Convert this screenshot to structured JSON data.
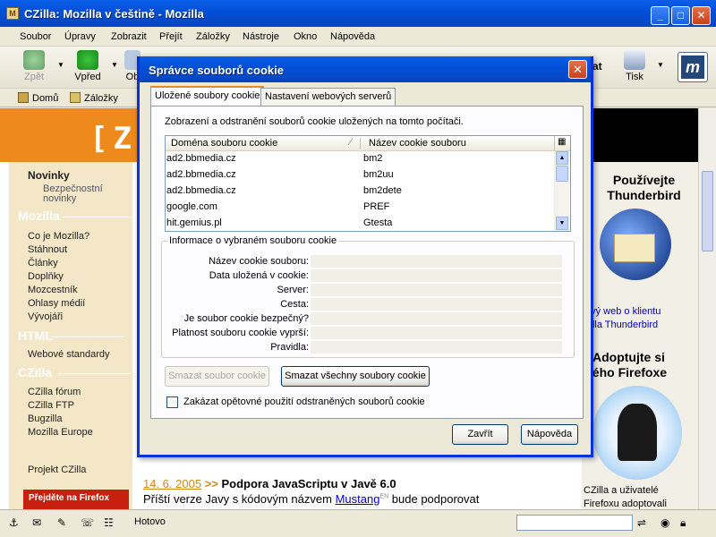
{
  "window": {
    "title": "CZilla: Mozilla v češtině - Mozilla"
  },
  "menu": [
    "Soubor",
    "Úpravy",
    "Zobrazit",
    "Přejít",
    "Záložky",
    "Nástroje",
    "Okno",
    "Nápověda"
  ],
  "toolbar": {
    "back": "Zpět",
    "forward": "Vpřed",
    "other": "Ob",
    "print": "Tisk",
    "search_frag": "at"
  },
  "personal": {
    "home": "Domů",
    "bookmarks": "Záložky"
  },
  "sidebar": {
    "news": "Novinky",
    "news_sub1": "Bezpečnostní",
    "news_sub2": "novinky",
    "sec_mozilla": "Mozilla",
    "mozilla_items": [
      "Co je Mozilla?",
      "Stáhnout",
      "Články",
      "Doplňky",
      "Mozcestník",
      "Ohlasy médií",
      "Vývojáři"
    ],
    "sec_html": "HTML",
    "html_items": [
      "Webové standardy"
    ],
    "sec_czilla": "CZilla",
    "czilla_items": [
      "CZilla fórum",
      "CZilla FTP",
      "Bugzilla",
      "Mozilla Europe"
    ],
    "project": "Projekt CZilla",
    "switch_btn": "Přejděte na Firefox"
  },
  "right": {
    "promo1": "Používejte Thunderbird",
    "promo1_link1": "ový web o klientu",
    "promo1_link2": "zilla Thunderbird",
    "promo2a": "Adoptujte si",
    "promo2b": "vého Firefoxe",
    "bottom1": "CZilla a uživatelé",
    "bottom2": "Firefoxu adoptovali"
  },
  "news": {
    "date": "14. 6. 2005",
    "arrows": ">>",
    "headline": "Podpora JavaScriptu v Javě 6.0",
    "text_pre": "Příští verze Javy s kódovým názvem ",
    "link": "Mustang",
    "sup": "EN",
    "text_post": " bude podporovat"
  },
  "status": {
    "text": "Hotovo"
  },
  "dialog": {
    "title": "Správce souborů cookie",
    "tabs": [
      "Uložené soubory cookie",
      "Nastavení webových serverů"
    ],
    "description": "Zobrazení a odstranění souborů cookie uložených na tomto počítači.",
    "col_domain": "Doména souboru cookie",
    "col_name": "Název cookie souboru",
    "rows": [
      {
        "domain": "ad2.bbmedia.cz",
        "name": "bm2"
      },
      {
        "domain": "ad2.bbmedia.cz",
        "name": "bm2uu"
      },
      {
        "domain": "ad2.bbmedia.cz",
        "name": "bm2dete"
      },
      {
        "domain": "google.com",
        "name": "PREF"
      },
      {
        "domain": "hit.gemius.pl",
        "name": "Gtesta"
      }
    ],
    "group_legend": "Informace o vybraném souboru cookie",
    "fields": [
      "Název cookie souboru:",
      "Data uložená v cookie:",
      "Server:",
      "Cesta:",
      "Je soubor cookie bezpečný?",
      "Platnost souboru cookie vyprší:",
      "Pravidla:"
    ],
    "btn_delete": "Smazat soubor cookie",
    "btn_delete_all": "Smazat všechny soubory cookie",
    "checkbox": "Zakázat opětovné použití odstraněných souborů cookie",
    "btn_close": "Zavřít",
    "btn_help": "Nápověda"
  },
  "colors": {
    "xp_blue": "#0a5fe8",
    "orange": "#ee8a1c",
    "link": "#0000cc",
    "news_date": "#d9860f"
  }
}
